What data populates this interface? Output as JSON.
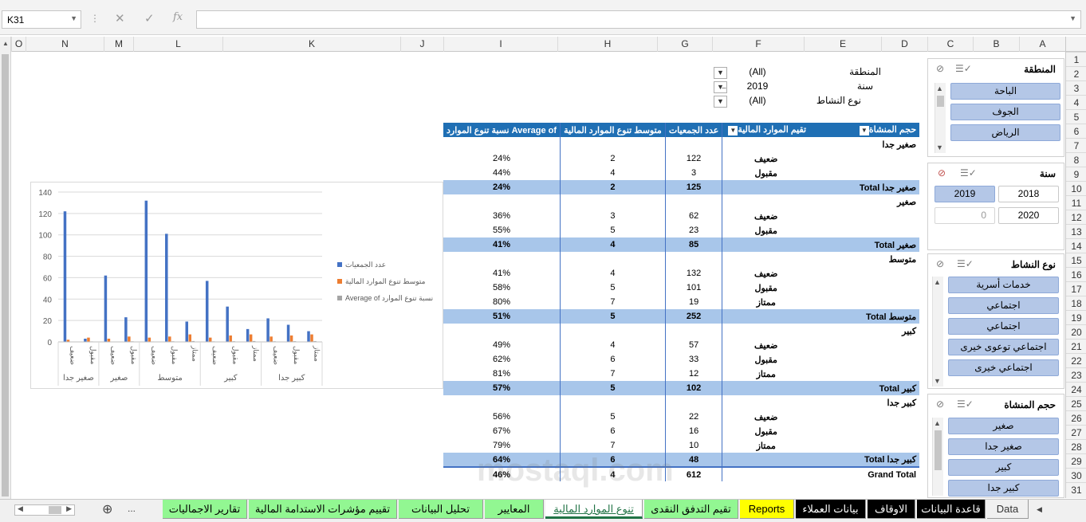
{
  "name_box": "K31",
  "formula": "",
  "columns": [
    "O",
    "N",
    "M",
    "L",
    "K",
    "J",
    "I",
    "H",
    "G",
    "F",
    "E",
    "D",
    "C",
    "B",
    "A"
  ],
  "rows": [
    "1",
    "2",
    "3",
    "4",
    "5",
    "6",
    "7",
    "8",
    "9",
    "10",
    "11",
    "12",
    "13",
    "14",
    "15",
    "16",
    "17",
    "18",
    "19",
    "20",
    "21",
    "22",
    "23",
    "24",
    "25",
    "26",
    "27",
    "28",
    "29",
    "30",
    "31"
  ],
  "filters": [
    {
      "label": "المنطقة",
      "value": "(All)"
    },
    {
      "label": "سنة",
      "value": "2019"
    },
    {
      "label": "نوع النشاط",
      "value": "(All)"
    }
  ],
  "pivot": {
    "headers": [
      "حجم المنشاة",
      "تقيم الموارد المالية",
      "عدد الجمعيات",
      "متوسط تنوع الموارد المالية",
      "Average of نسبة تنوع الموارد"
    ],
    "rows": [
      {
        "kind": "group",
        "a": "صغير جدا"
      },
      {
        "kind": "data",
        "b": "ضعيف",
        "c": "122",
        "d": "2",
        "e": "24%"
      },
      {
        "kind": "data",
        "b": "مقبول",
        "c": "3",
        "d": "4",
        "e": "44%"
      },
      {
        "kind": "total",
        "a": "صغير جدا Total",
        "c": "125",
        "d": "2",
        "e": "24%"
      },
      {
        "kind": "group",
        "a": "صغير"
      },
      {
        "kind": "data",
        "b": "ضعيف",
        "c": "62",
        "d": "3",
        "e": "36%"
      },
      {
        "kind": "data",
        "b": "مقبول",
        "c": "23",
        "d": "5",
        "e": "55%"
      },
      {
        "kind": "total",
        "a": "صغير Total",
        "c": "85",
        "d": "4",
        "e": "41%"
      },
      {
        "kind": "group",
        "a": "متوسط"
      },
      {
        "kind": "data",
        "b": "ضعيف",
        "c": "132",
        "d": "4",
        "e": "41%"
      },
      {
        "kind": "data",
        "b": "مقبول",
        "c": "101",
        "d": "5",
        "e": "58%"
      },
      {
        "kind": "data",
        "b": "ممتاز",
        "c": "19",
        "d": "7",
        "e": "80%"
      },
      {
        "kind": "total",
        "a": "متوسط Total",
        "c": "252",
        "d": "5",
        "e": "51%"
      },
      {
        "kind": "group",
        "a": "كبير"
      },
      {
        "kind": "data",
        "b": "ضعيف",
        "c": "57",
        "d": "4",
        "e": "49%"
      },
      {
        "kind": "data",
        "b": "مقبول",
        "c": "33",
        "d": "6",
        "e": "62%"
      },
      {
        "kind": "data",
        "b": "ممتاز",
        "c": "12",
        "d": "7",
        "e": "81%"
      },
      {
        "kind": "total",
        "a": "كبير Total",
        "c": "102",
        "d": "5",
        "e": "57%"
      },
      {
        "kind": "group",
        "a": "كبير جدا"
      },
      {
        "kind": "data",
        "b": "ضعيف",
        "c": "22",
        "d": "5",
        "e": "56%"
      },
      {
        "kind": "data",
        "b": "مقبول",
        "c": "16",
        "d": "6",
        "e": "67%"
      },
      {
        "kind": "data",
        "b": "ممتاز",
        "c": "10",
        "d": "7",
        "e": "79%"
      },
      {
        "kind": "total",
        "a": "كبير جدا Total",
        "c": "48",
        "d": "6",
        "e": "64%"
      },
      {
        "kind": "grand",
        "a": "Grand Total",
        "c": "612",
        "d": "4",
        "e": "46%"
      }
    ]
  },
  "chart_data": {
    "type": "bar",
    "ylim": [
      0,
      140
    ],
    "yticks": [
      "0",
      "20",
      "40",
      "60",
      "80",
      "100",
      "120",
      "140"
    ],
    "categories": [
      "ضعيف",
      "مقبول",
      "ضعيف",
      "مقبول",
      "ضعيف",
      "مقبول",
      "ممتاز",
      "ضعيف",
      "مقبول",
      "ممتاز",
      "ضعيف",
      "مقبول",
      "ممتاز"
    ],
    "groups": [
      {
        "label": "صغير جدا",
        "count": 2
      },
      {
        "label": "صغير",
        "count": 2
      },
      {
        "label": "متوسط",
        "count": 3
      },
      {
        "label": "كبير",
        "count": 3
      },
      {
        "label": "كبير جدا",
        "count": 3
      }
    ],
    "series": [
      {
        "name": "عدد الجمعيات",
        "color": "#4472c4",
        "values": [
          122,
          3,
          62,
          23,
          132,
          101,
          19,
          57,
          33,
          12,
          22,
          16,
          10
        ]
      },
      {
        "name": "متوسط تنوع الموارد المالية",
        "color": "#ed7d31",
        "values": [
          2,
          4,
          3,
          5,
          4,
          5,
          7,
          4,
          6,
          7,
          5,
          6,
          7
        ]
      },
      {
        "name": "Average of نسبة تنوع الموارد",
        "color": "#a5a5a5",
        "values": [
          0.24,
          0.44,
          0.36,
          0.55,
          0.41,
          0.58,
          0.8,
          0.49,
          0.62,
          0.81,
          0.56,
          0.67,
          0.79
        ]
      }
    ],
    "legend": "right"
  },
  "slicers": {
    "region": {
      "title": "المنطقة",
      "items": [
        "الباحة",
        "الجوف",
        "الرياض"
      ]
    },
    "year": {
      "title": "سنة",
      "items": [
        "2018",
        "2019",
        "2020",
        "0"
      ],
      "selected": "2019"
    },
    "activity": {
      "title": "نوع النشاط",
      "items": [
        "خدمات أسرية",
        "اجتماعي",
        "اجتماعي",
        "اجتماعي توعوى خيرى",
        "اجتماعي خيرى"
      ]
    },
    "size": {
      "title": "حجم المنشاة",
      "items": [
        "صغير",
        "صغير جدا",
        "كبير",
        "كبير جدا"
      ]
    }
  },
  "sheet_tabs": [
    {
      "label": "Data",
      "bg": "#f0f0f0",
      "fg": "#333333"
    },
    {
      "label": "قاعدة البيانات",
      "bg": "#000000",
      "fg": "#ffffff"
    },
    {
      "label": "الاوقاف",
      "bg": "#000000",
      "fg": "#ffffff"
    },
    {
      "label": "بيانات العملاء",
      "bg": "#000000",
      "fg": "#ffffff"
    },
    {
      "label": "Reports",
      "bg": "#ffff00",
      "fg": "#000000"
    },
    {
      "label": "تقيم التدفق النقدى",
      "bg": "#92f792",
      "fg": "#000000"
    },
    {
      "label": "تنوع الموارد المالية",
      "bg": "#ffffff",
      "fg": "#217346",
      "active": true
    },
    {
      "label": "المعايير",
      "bg": "#92f792",
      "fg": "#000000"
    },
    {
      "label": "تحليل البيانات",
      "bg": "#92f792",
      "fg": "#000000"
    },
    {
      "label": "تقييم مؤشرات الاستدامة المالية",
      "bg": "#92f792",
      "fg": "#000000"
    },
    {
      "label": "تقارير الاجماليات",
      "bg": "#92f792",
      "fg": "#000000"
    }
  ],
  "tabs_more": "...",
  "watermark": "mostaql.com"
}
